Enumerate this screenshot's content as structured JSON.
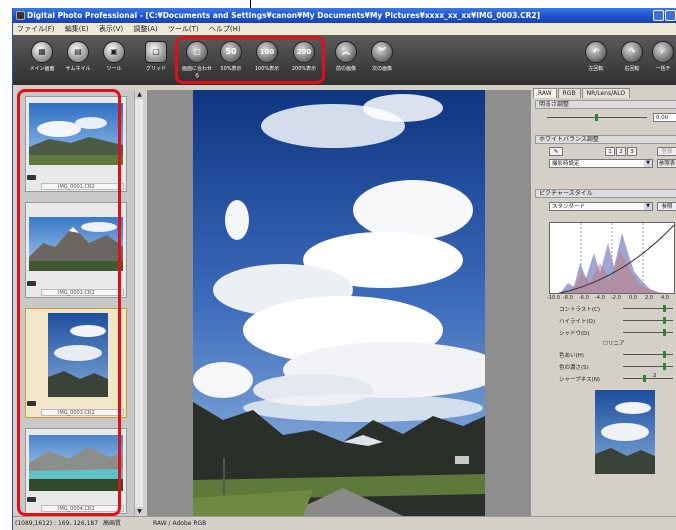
{
  "window": {
    "title": "Digital Photo Professional - [C:¥Documents and Settings¥canon¥My Documents¥My Pictures¥xxxx_xx_xx¥IMG_0003.CR2]"
  },
  "menu": [
    "ファイル(F)",
    "編集(E)",
    "表示(V)",
    "調整(A)",
    "ツール(T)",
    "ヘルプ(H)"
  ],
  "toolbar": {
    "main_window": "メイン画面",
    "thumbnail": "サムネイル",
    "tool": "ツール",
    "grid": "グリッド",
    "fit_window": "画面に合わせる",
    "fit_glyph": "▢",
    "zoom50": "50%表示",
    "zoom50_glyph": "50",
    "zoom100": "100%表示",
    "zoom100_glyph": "100",
    "zoom200": "200%表示",
    "zoom200_glyph": "200",
    "prev_image": "前の画像",
    "next_image": "次の画像",
    "rotate_left": "左回転",
    "rotate_right": "右回転",
    "check": "一括チ"
  },
  "thumbnails": [
    {
      "name": "IMG_0001.CR2"
    },
    {
      "name": "IMG_0002.CR2"
    },
    {
      "name": "IMG_0003.CR2"
    },
    {
      "name": "IMG_0004.CR2"
    }
  ],
  "panel": {
    "tabs": [
      "RAW",
      "RGB",
      "NR/Lens/ALO"
    ],
    "brightness_title": "明るさ調整",
    "brightness_value": "0.00",
    "wb_title": "ホワイトバランス調整",
    "wb_presets": [
      "1",
      "2",
      "3"
    ],
    "wb_register": "登録",
    "wb_select": "撮影時設定",
    "wb_browse": "参照表",
    "picture_style_title": "ピクチャースタイル",
    "picture_style_select": "スタンダード",
    "picture_style_browse": "参照",
    "histo_axis": [
      "-10.0",
      "-8.0",
      "-6.0",
      "-4.0",
      "-2.0",
      "0.0",
      "2.0",
      "4.0"
    ],
    "contrast": "コントラスト(C)",
    "highlight": "ハイライト(O)",
    "shadow": "シャドウ(D)",
    "linear": "リニア",
    "color_tone": "色あい(H)",
    "saturation": "色の濃さ(S)",
    "sharpness": "シャープネス(N)",
    "slider_value": "2"
  },
  "status": {
    "coords": "(1089,1612) : 169, 126,187",
    "mode": "高画質",
    "colorspace": "RAW / Adobe RGB"
  },
  "colors": {
    "highlight_red": "#e0101a",
    "titlebar_blue": "#1d50c8"
  }
}
